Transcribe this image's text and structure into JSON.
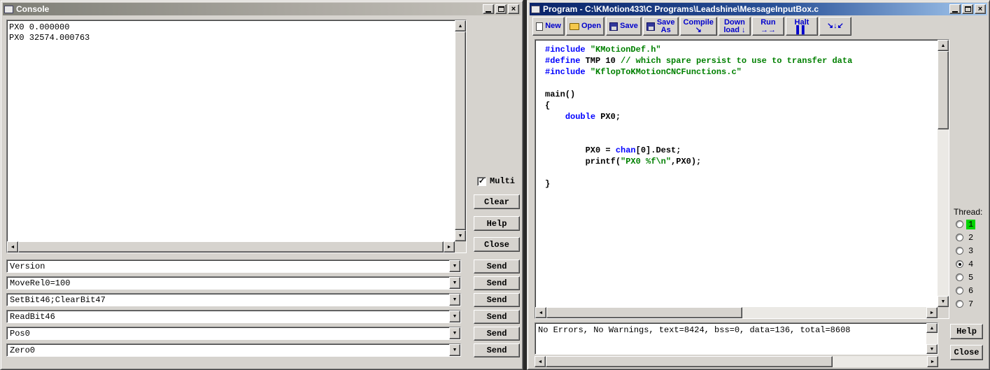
{
  "console": {
    "title": "Console",
    "output_lines": [
      "PX0 0.000000",
      "PX0 32574.000763"
    ],
    "multi_label": "Multi",
    "multi_checked": true,
    "buttons": {
      "clear": "Clear",
      "help": "Help",
      "close": "Close"
    },
    "send_label": "Send",
    "commands": [
      "Version",
      "MoveRel0=100",
      "SetBit46;ClearBit47",
      "ReadBit46",
      "Pos0",
      "Zero0"
    ]
  },
  "program": {
    "title": "Program - C:\\KMotion433\\C Programs\\Leadshine\\MessageInputBox.c",
    "toolbar": [
      {
        "name": "new",
        "icon": "page",
        "lines": [
          "New"
        ]
      },
      {
        "name": "open",
        "icon": "folder",
        "lines": [
          "Open"
        ]
      },
      {
        "name": "save",
        "icon": "disk",
        "lines": [
          "Save"
        ]
      },
      {
        "name": "save-as",
        "icon": "disk",
        "lines": [
          "Save",
          "As"
        ]
      },
      {
        "name": "compile",
        "icon": "",
        "lines": [
          "Compile",
          "↘"
        ]
      },
      {
        "name": "download",
        "icon": "",
        "lines": [
          "Down",
          "load ↓"
        ]
      },
      {
        "name": "run",
        "icon": "",
        "lines": [
          "Run",
          "→→"
        ]
      },
      {
        "name": "halt",
        "icon": "",
        "lines": [
          "Halt",
          "▌▌"
        ]
      },
      {
        "name": "step",
        "icon": "",
        "lines": [
          "↘↓↙"
        ]
      }
    ],
    "code_lines": [
      [
        {
          "c": "b",
          "t": "#include "
        },
        {
          "c": "g",
          "t": "\"KMotionDef.h\""
        }
      ],
      [
        {
          "c": "b",
          "t": "#define "
        },
        {
          "c": "k",
          "t": "TMP 10 "
        },
        {
          "c": "g",
          "t": "// which spare persist to use to transfer data"
        }
      ],
      [
        {
          "c": "b",
          "t": "#include "
        },
        {
          "c": "g",
          "t": "\"KflopToKMotionCNCFunctions.c\""
        }
      ],
      [],
      [
        {
          "c": "k",
          "t": "main()"
        }
      ],
      [
        {
          "c": "k",
          "t": "{"
        }
      ],
      [
        {
          "c": "k",
          "t": "    "
        },
        {
          "c": "b",
          "t": "double"
        },
        {
          "c": "k",
          "t": " PX0;"
        }
      ],
      [],
      [],
      [
        {
          "c": "k",
          "t": "        PX0 = "
        },
        {
          "c": "b",
          "t": "chan"
        },
        {
          "c": "k",
          "t": "[0].Dest;"
        }
      ],
      [
        {
          "c": "k",
          "t": "        printf("
        },
        {
          "c": "g",
          "t": "\"PX0 %f\\n\""
        },
        {
          "c": "k",
          "t": ",PX0);"
        }
      ],
      [],
      [
        {
          "c": "k",
          "t": "}"
        }
      ]
    ],
    "thread": {
      "label": "Thread:",
      "options": [
        "1",
        "2",
        "3",
        "4",
        "5",
        "6",
        "7"
      ],
      "selected": "4",
      "running": "1"
    },
    "status_text": "No Errors, No Warnings, text=8424, bss=0, data=136, total=8608",
    "help_label": "Help",
    "close_label": "Close"
  }
}
